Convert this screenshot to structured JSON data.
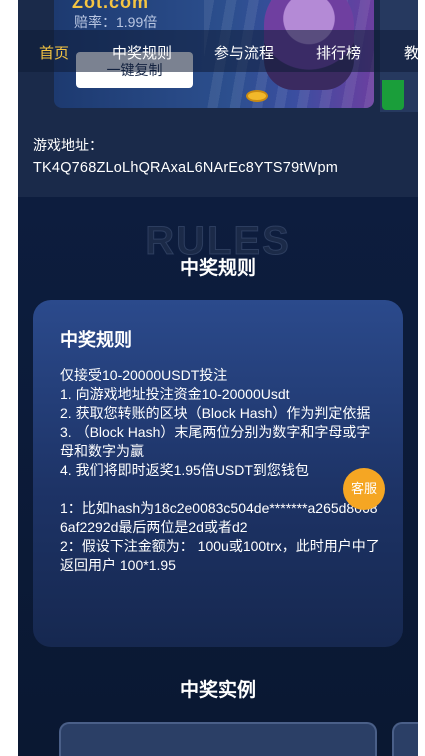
{
  "banner": {
    "logo_text": "Zot.com",
    "rate_text": "赔率：1.99倍",
    "copy_button": "一键复制"
  },
  "nav": {
    "items": [
      {
        "label": "首页",
        "active": true
      },
      {
        "label": "中奖规则",
        "active": false
      },
      {
        "label": "参与流程",
        "active": false
      },
      {
        "label": "排行榜",
        "active": false
      },
      {
        "label": "教",
        "active": false
      }
    ]
  },
  "address": {
    "label": "游戏地址：",
    "value": "TK4Q768ZLoLhQRAxaL6NArEc8YTS79tWpm"
  },
  "rules": {
    "watermark": "RULES",
    "section_title": "中奖规则",
    "card_title": "中奖规则",
    "lines": [
      "仅接受10-20000USDT投注",
      "1. 向游戏地址投注资金10-20000Usdt",
      "2. 获取您转账的区块（Block Hash）作为判定依据",
      "3. （Block Hash）末尾两位分别为数字和字母或字母和数字为赢",
      "4. 我们将即时返奖1.95倍USDT到您钱包",
      "",
      "1：比如hash为18c2e0083c504de*******a265d80686af2292d最后两位是2d或者d2",
      "2：假设下注金额为： 100u或100trx，此时用户中了 返回用户 100*1.95"
    ]
  },
  "examples": {
    "title": "中奖实例"
  },
  "service": {
    "label": "客服"
  },
  "colors": {
    "accent": "#f5c542",
    "page_bg": "#0b1a36",
    "card_bg": "#2b4a8c",
    "service_button": "#f5a623"
  }
}
